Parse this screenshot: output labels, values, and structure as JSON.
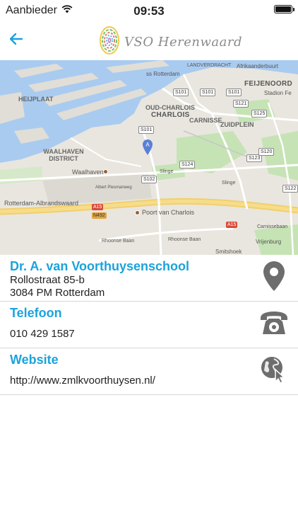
{
  "status": {
    "carrier": "Aanbieder",
    "time": "09:53",
    "battery_level": 1.0
  },
  "nav": {
    "back_icon": "arrow-left-icon",
    "logo_text": "VSO Herenwaard",
    "accent": "#1aa3dc"
  },
  "map": {
    "labels": {
      "afrikaanderbuurt": "Afrikaanderbuurt",
      "landverdracht": "LANDVERDRACHT",
      "ss_rotterdam": "ss Rotterdam",
      "feijenoord": "FEIJENOORD",
      "stadion": "Stadion Fe",
      "heijplaat": "HEIJPLAAT",
      "oud_charlois": "OUD-CHARLOIS",
      "charlois": "CHARLOIS",
      "carnisse": "CARNISSE",
      "zuidplein": "ZUIDPLEIN",
      "waalhaven_district": "WAALHAVEN DISTRICT",
      "waalhaven": "Waalhaven",
      "albert": "Albert Plesmanweg",
      "rotterdam_albrandswaard": "Rotterdam-Albrandswaard",
      "poort_van_charlois": "Poort van Charlois",
      "rhoonse_baan": "Rhoonse Baan",
      "smitshoek": "Smitshoek",
      "vrijenburg": "Vrijenburg",
      "carnissebaan": "Carnissebaan",
      "slinge": "Slinge",
      "pin_letter": "A"
    },
    "shields": {
      "s101a": "S101",
      "s101b": "S101",
      "s101c": "S101",
      "s101d": "S101",
      "s102": "S102",
      "s121": "S121",
      "s124": "S124",
      "s125": "S125",
      "s123": "S123",
      "s120": "S120",
      "s122": "S122",
      "a15a": "A15",
      "a15b": "A15",
      "n492": "N492"
    }
  },
  "contact": {
    "school_name": "Dr. A. van Voorthuysenschool",
    "street": "Rollostraat 85-b",
    "city": "3084 PM Rotterdam",
    "phone_title": "Telefoon",
    "phone_number": "010 429 1587",
    "website_title": "Website",
    "website_url": "http://www.zmlkvoorthuysen.nl/"
  }
}
